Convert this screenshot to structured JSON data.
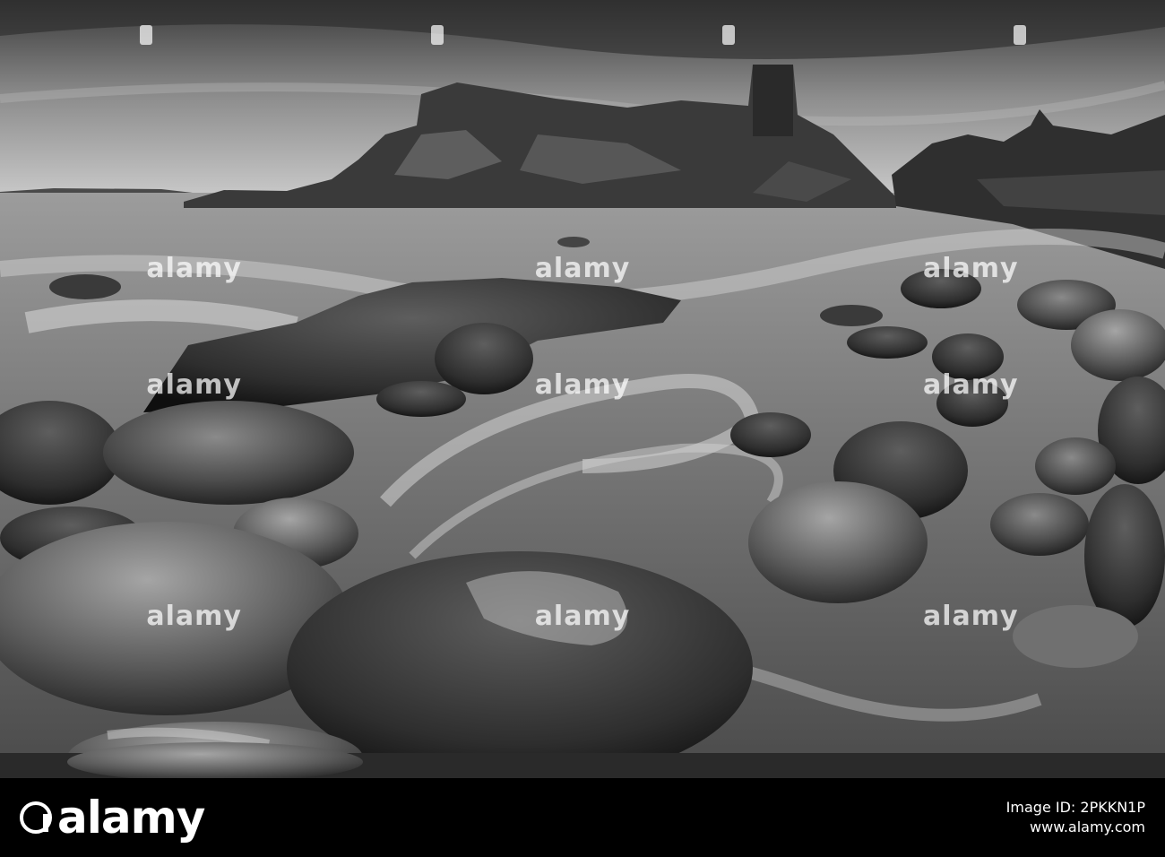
{
  "watermark": {
    "text": "alamy",
    "rows": [
      [
        "alamy",
        "alamy",
        "alamy"
      ],
      [
        "alamy",
        "alamy",
        "alamy"
      ],
      [
        "alamy",
        "alamy",
        "alamy"
      ]
    ]
  },
  "footer": {
    "brand": "alamy",
    "image_id_label": "Image ID: 2PKKN1P",
    "site": "www.alamy.com"
  }
}
